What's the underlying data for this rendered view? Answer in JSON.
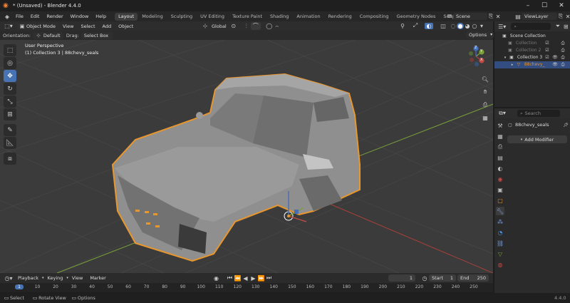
{
  "window": {
    "title": "* (Unsaved) - Blender 4.4.0"
  },
  "menu": [
    "File",
    "Edit",
    "Render",
    "Window",
    "Help"
  ],
  "workspaces": [
    "Layout",
    "Modeling",
    "Sculpting",
    "UV Editing",
    "Texture Paint",
    "Shading",
    "Animation",
    "Rendering",
    "Compositing",
    "Geometry Nodes",
    "Scripting"
  ],
  "active_workspace": "Layout",
  "scene": {
    "name": "Scene",
    "view_layer": "ViewLayer"
  },
  "viewport_header": {
    "mode": "Object Mode",
    "menus": [
      "View",
      "Select",
      "Add",
      "Object"
    ],
    "transform": "Global"
  },
  "tool_settings": {
    "orientation_label": "Orientation:",
    "orientation_value": "Default",
    "drag_label": "Drag:",
    "drag_value": "Select Box",
    "options": "Options"
  },
  "viewport": {
    "overlay_line1": "User Perspective",
    "overlay_line2": "(1) Collection 3 | 88chevy_seals",
    "gizmo": {
      "x": "X",
      "y": "Y",
      "z": "Z"
    }
  },
  "outliner": {
    "root": "Scene Collection",
    "items": [
      {
        "label": "Collection",
        "dimmed": true
      },
      {
        "label": "Collection 2",
        "dimmed": true
      },
      {
        "label": "Collection 3",
        "dimmed": false
      },
      {
        "label": "88chevy_",
        "dimmed": false,
        "selected": true
      }
    ]
  },
  "properties": {
    "object_name": "88chevy_seals",
    "add_modifier": "Add Modifier",
    "search_placeholder": "Search"
  },
  "timeline": {
    "menus": [
      "Playback",
      "Keying",
      "View",
      "Marker"
    ],
    "current_frame": "1",
    "start_label": "Start",
    "start": "1",
    "end_label": "End",
    "end": "250",
    "ruler": [
      "1",
      "10",
      "20",
      "30",
      "40",
      "50",
      "60",
      "70",
      "80",
      "90",
      "100",
      "110",
      "120",
      "130",
      "140",
      "150",
      "160",
      "170",
      "180",
      "190",
      "200",
      "210",
      "220",
      "230",
      "240",
      "250"
    ]
  },
  "status": {
    "select": "Select",
    "rotate_view": "Rotate View",
    "options": "Options",
    "version": "4.4.0"
  },
  "colors": {
    "accent": "#4772b3",
    "selection_outline": "#e8962e",
    "x_axis": "#a8403a",
    "y_axis": "#7aa13a"
  }
}
